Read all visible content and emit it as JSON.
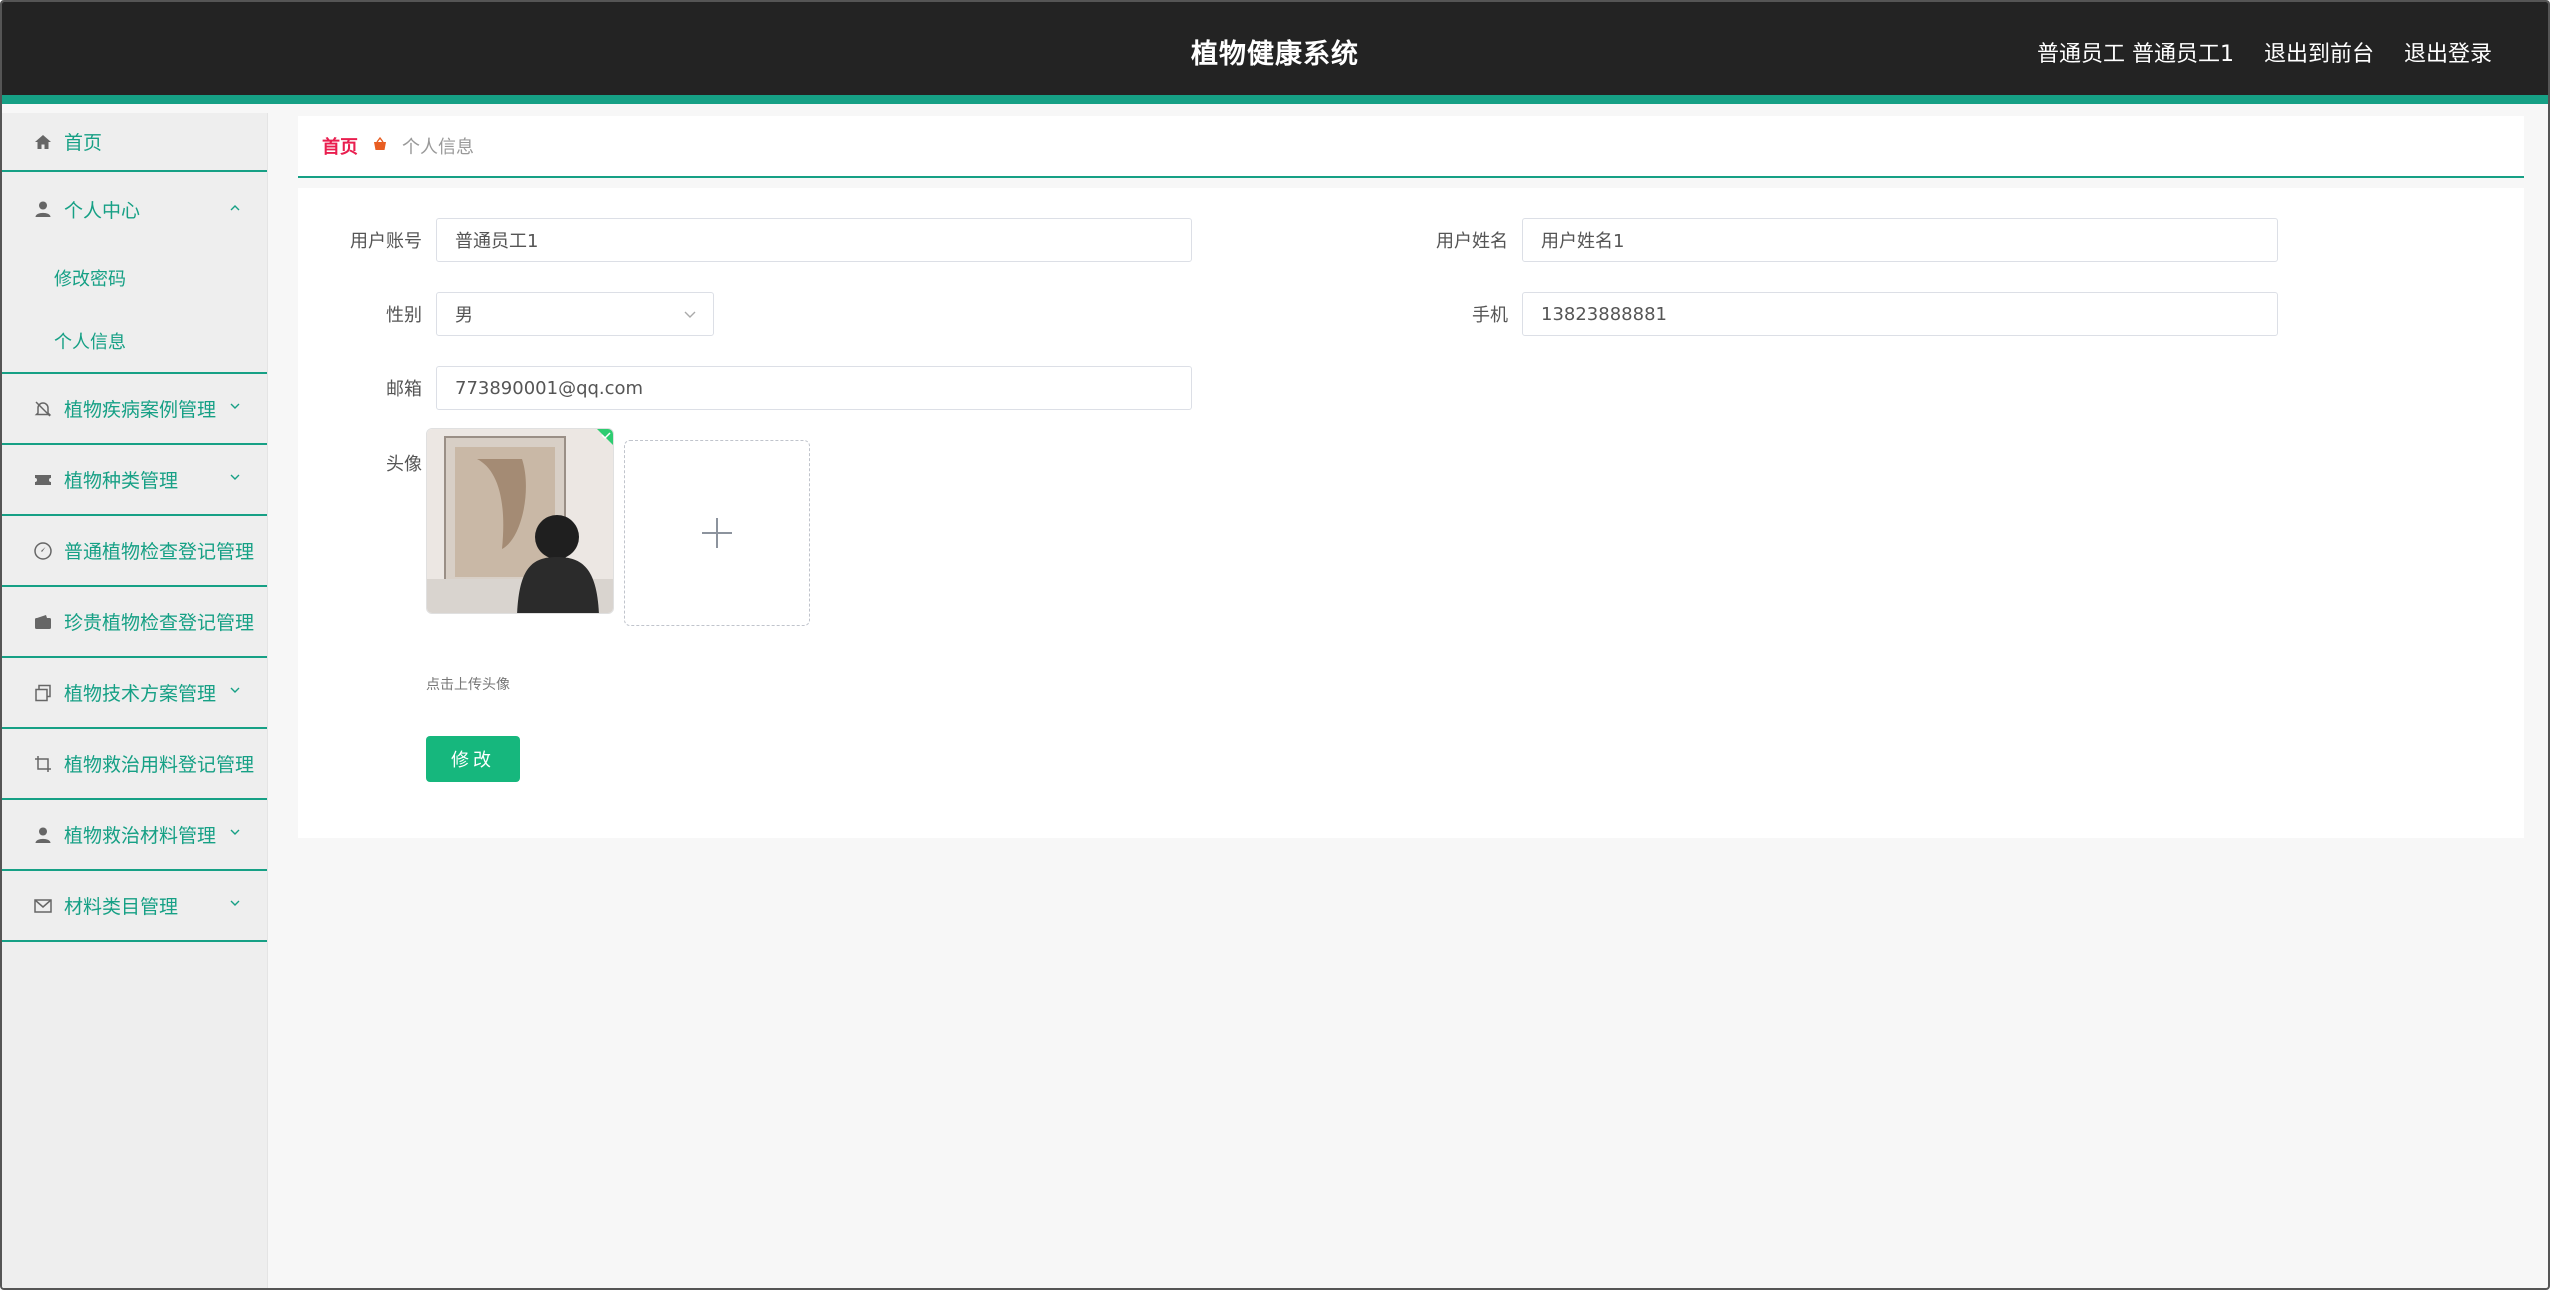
{
  "header": {
    "title": "植物健康系统",
    "user_label": "普通员工 普通员工1",
    "back_label": "退出到前台",
    "logout_label": "退出登录"
  },
  "sidebar": {
    "home": {
      "label": "首页",
      "icon": "home-icon"
    },
    "personal_center": {
      "label": "个人中心",
      "icon": "user-icon",
      "children": [
        "修改密码",
        "个人信息"
      ]
    },
    "items": [
      {
        "label": "植物疾病案例管理",
        "icon": "bell-off-icon"
      },
      {
        "label": "植物种类管理",
        "icon": "ticket-icon"
      },
      {
        "label": "普通植物检查登记管理",
        "icon": "compass-icon"
      },
      {
        "label": "珍贵植物检查登记管理",
        "icon": "wallet-icon"
      },
      {
        "label": "植物技术方案管理",
        "icon": "copy-icon"
      },
      {
        "label": "植物救治用料登记管理",
        "icon": "crop-icon"
      },
      {
        "label": "植物救治材料管理",
        "icon": "user-icon"
      },
      {
        "label": "材料类目管理",
        "icon": "mail-icon"
      }
    ]
  },
  "breadcrumb": {
    "home": "首页",
    "current": "个人信息"
  },
  "form": {
    "account_label": "用户账号",
    "account_value": "普通员工1",
    "name_label": "用户姓名",
    "name_value": "用户姓名1",
    "gender_label": "性别",
    "gender_value": "男",
    "phone_label": "手机",
    "phone_value": "13823888881",
    "email_label": "邮箱",
    "email_value": "773890001@qq.com",
    "avatar_label": "头像",
    "upload_hint": "点击上传头像",
    "submit_label": "修改"
  },
  "colors": {
    "accent": "#16a085",
    "header_bg": "#232323",
    "submit": "#16b77d",
    "breadcrumb_home": "#e91e4f"
  }
}
